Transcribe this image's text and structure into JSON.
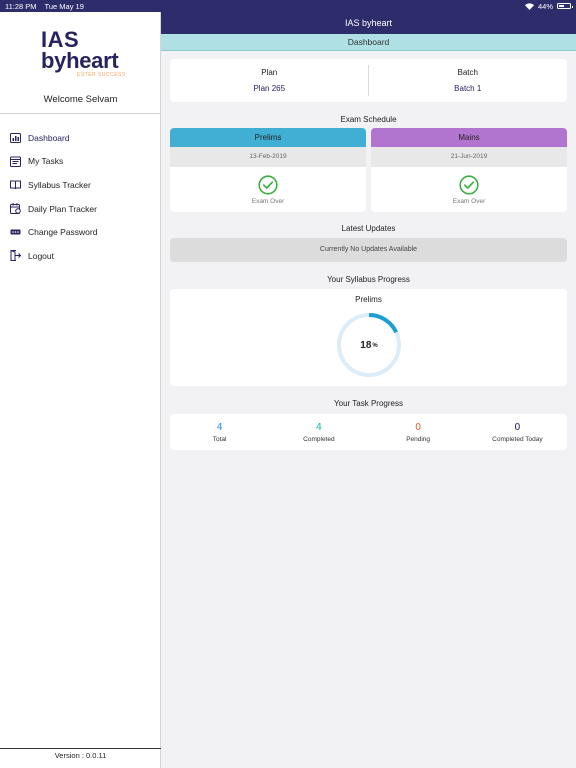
{
  "status_bar": {
    "time": "11:28 PM",
    "date": "Tue May 19",
    "battery": "44%",
    "battery_level": 0.44
  },
  "sidebar": {
    "logo": {
      "line1": "IAS",
      "line2": "byheart",
      "tagline": "ESTER SUCCESS"
    },
    "welcome": "Welcome Selvam",
    "items": [
      {
        "label": "Dashboard",
        "icon": "dashboard-icon",
        "active": true
      },
      {
        "label": "My Tasks",
        "icon": "tasks-icon"
      },
      {
        "label": "Syllabus Tracker",
        "icon": "book-icon"
      },
      {
        "label": "Daily Plan Tracker",
        "icon": "calendar-icon"
      },
      {
        "label": "Change Password",
        "icon": "password-icon"
      },
      {
        "label": "Logout",
        "icon": "logout-icon"
      }
    ],
    "version": "Version : 0.0.11"
  },
  "header": {
    "title": "IAS byheart"
  },
  "breadcrumb": "Dashboard",
  "plan": {
    "plan_label": "Plan",
    "plan_value": "Plan 265",
    "batch_label": "Batch",
    "batch_value": "Batch 1"
  },
  "exam_schedule": {
    "title": "Exam Schedule",
    "exams": [
      {
        "name": "Prelims",
        "date": "13-Feb-2019",
        "status": "Exam Over",
        "color": "#41afd3"
      },
      {
        "name": "Mains",
        "date": "21-Jun-2019",
        "status": "Exam Over",
        "color": "#b275cf"
      }
    ]
  },
  "latest_updates": {
    "title": "Latest Updates",
    "message": "Currently No Updates Available"
  },
  "syllabus_progress": {
    "title": "Your Syllabus Progress",
    "label": "Prelims",
    "percent": 18,
    "percent_text": "18",
    "unit": "%"
  },
  "task_progress": {
    "title": "Your Task Progress",
    "stats": [
      {
        "value": "4",
        "label": "Total",
        "color": "#2f8be0"
      },
      {
        "value": "4",
        "label": "Completed",
        "color": "#1fb7a8"
      },
      {
        "value": "0",
        "label": "Pending",
        "color": "#e0642c"
      },
      {
        "value": "0",
        "label": "Completed Today",
        "color": "#26235f"
      }
    ]
  },
  "colors": {
    "primary": "#2e2d6b",
    "breadcrumb_bg": "#aee0e4",
    "check_green": "#3cb043",
    "ring_fg": "#1b9fd1",
    "ring_bg": "#dcecf8"
  }
}
